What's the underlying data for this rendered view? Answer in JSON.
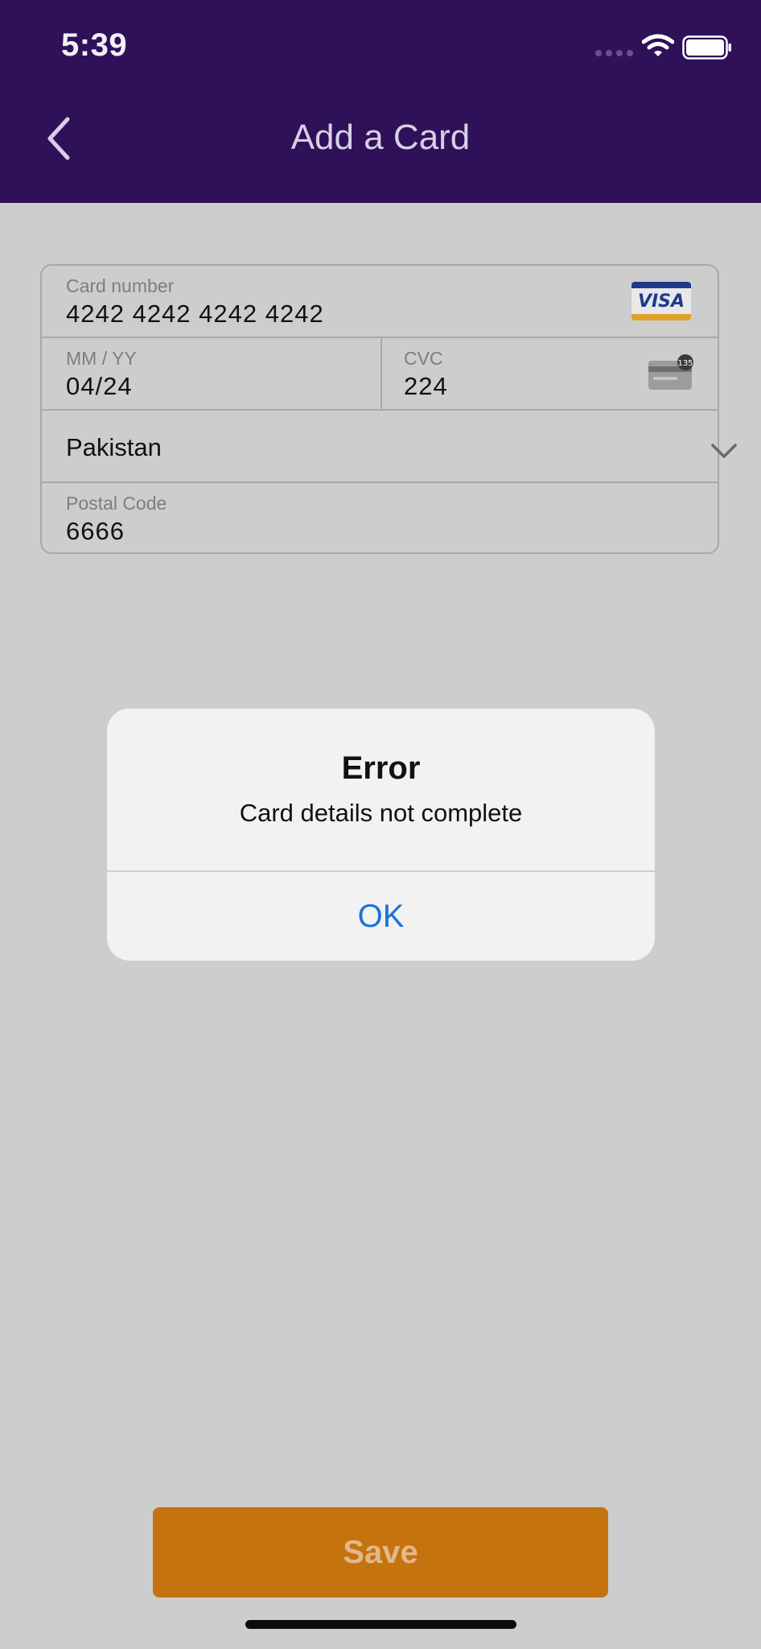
{
  "status_bar": {
    "time": "5:39",
    "icons": [
      "signal-dots-icon",
      "wifi-icon",
      "battery-icon"
    ]
  },
  "header": {
    "title": "Add a Card",
    "back_icon": "chevron-left-icon",
    "background_color": "#2f1159"
  },
  "form": {
    "card_number": {
      "label": "Card number",
      "value": "4242 4242 4242 4242",
      "brand_icon": "visa-icon",
      "brand_text": "VISA"
    },
    "expiry": {
      "label": "MM / YY",
      "value": "04/24"
    },
    "cvc": {
      "label": "CVC",
      "value": "224",
      "icon": "cvc-card-icon",
      "badge": "135"
    },
    "country": {
      "value": "Pakistan",
      "icon": "chevron-down-icon"
    },
    "postal_code": {
      "label": "Postal Code",
      "value": "6666"
    }
  },
  "alert": {
    "title": "Error",
    "message": "Card details not complete",
    "ok_label": "OK",
    "ok_color": "#1a74d9"
  },
  "footer": {
    "save_label": "Save",
    "save_color": "#c4730f"
  }
}
